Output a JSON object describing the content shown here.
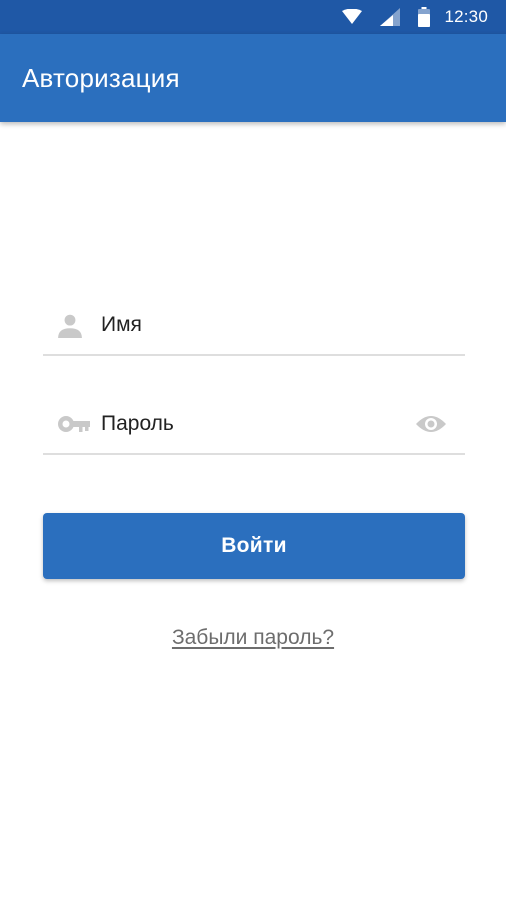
{
  "status_bar": {
    "time": "12:30",
    "icons": [
      "wifi-icon",
      "signal-icon",
      "battery-icon"
    ]
  },
  "app_bar": {
    "title": "Авторизация"
  },
  "form": {
    "name_field": {
      "placeholder": "Имя",
      "value": "",
      "icon": "person-icon"
    },
    "password_field": {
      "placeholder": "Пароль",
      "value": "",
      "icon": "key-icon",
      "toggle_icon": "eye-icon"
    },
    "login_button_label": "Войти",
    "forgot_password_label": "Забыли пароль?"
  },
  "colors": {
    "status_bar": "#1f58a6",
    "primary": "#2b6fbe",
    "field_icon": "#c9c9c9",
    "divider": "#dedede",
    "link": "#6d6d6d"
  }
}
